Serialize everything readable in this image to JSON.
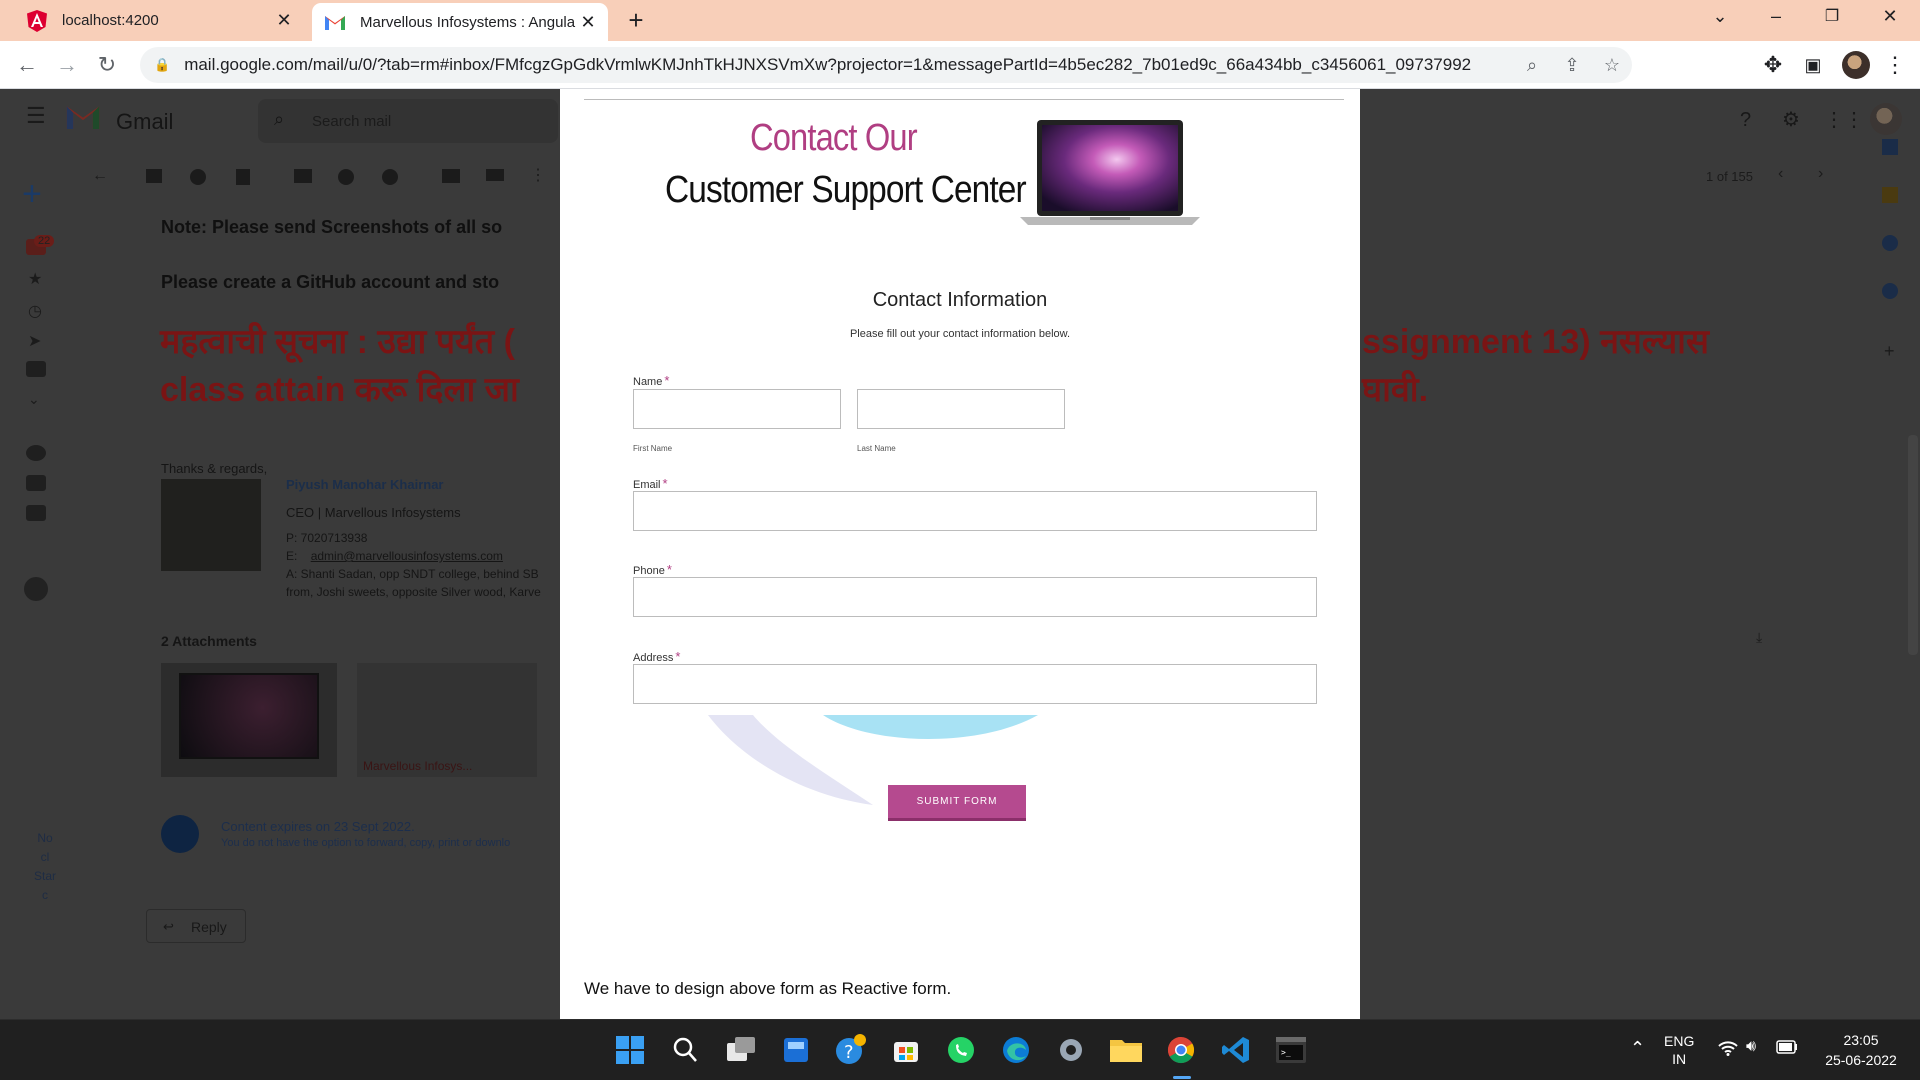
{
  "browser": {
    "tabs": [
      {
        "title": "localhost:4200",
        "icon": "angular-icon"
      },
      {
        "title": "Marvellous Infosystems : Angular",
        "icon": "gmail-icon",
        "active": true
      }
    ],
    "url": "mail.google.com/mail/u/0/?tab=rm#inbox/FMfcgzGpGdkVrmlwKMJnhTkHJNXSVmXw?projector=1&messagePartId=4b5ec282_7b01ed9c_66a434bb_c3456061_09737992"
  },
  "gmail": {
    "app_name": "Gmail",
    "search_placeholder": "Search mail",
    "unread_badge": "22",
    "page_count": "1 of 155",
    "note_line": "Note: Please send Screenshots of all so",
    "github_line": "Please create a GitHub account and sto",
    "marathi_line1_left": "महत्वाची सूचना : उद्या पर्यंत (",
    "marathi_line1_right": "ssignment 13) नसल्यास",
    "marathi_line2_left": "class attain करू दिला जा",
    "marathi_line2_right": "घावी.",
    "signature": {
      "regards": "Thanks & regards,",
      "name": "Piyush Manohar Khairnar",
      "role": "CEO | Marvellous Infosystems",
      "phone": "P:  7020713938",
      "email_prefix": "E:",
      "email": "admin@marvellousinfosystems.com",
      "address1": "A:  Shanti Sadan, opp SNDT college, behind SB",
      "address2": "from, Joshi sweets, opposite Silver wood, Karve"
    },
    "attachments_label": "2 Attachments",
    "attachment_name": "Marvellous Infosys...",
    "expiry": "Content expires on 23 Sept 2022.",
    "expiry_sub": "You do not have the option to forward, copy, print or downlo",
    "reply": "Reply",
    "side_text": [
      "No",
      "cl",
      "Star",
      "c"
    ]
  },
  "projector": {
    "header_line1": "Contact Our",
    "header_line2": "Customer Support Center",
    "form_title": "Contact Information",
    "form_subtitle": "Please fill out your contact information below.",
    "fields": {
      "name": "Name",
      "first_name": "First Name",
      "last_name": "Last Name",
      "email": "Email",
      "phone": "Phone",
      "address": "Address"
    },
    "required_mark": "*",
    "submit": "SUBMIT FORM",
    "note": "We have to design above form as Reactive form."
  },
  "taskbar": {
    "lang_top": "ENG",
    "lang_bottom": "IN",
    "time": "23:05",
    "date": "25-06-2022"
  },
  "colors": {
    "tab_strip": "#f8cfb9",
    "form_accent": "#b03e82",
    "marathi_text": "#7a1414"
  }
}
